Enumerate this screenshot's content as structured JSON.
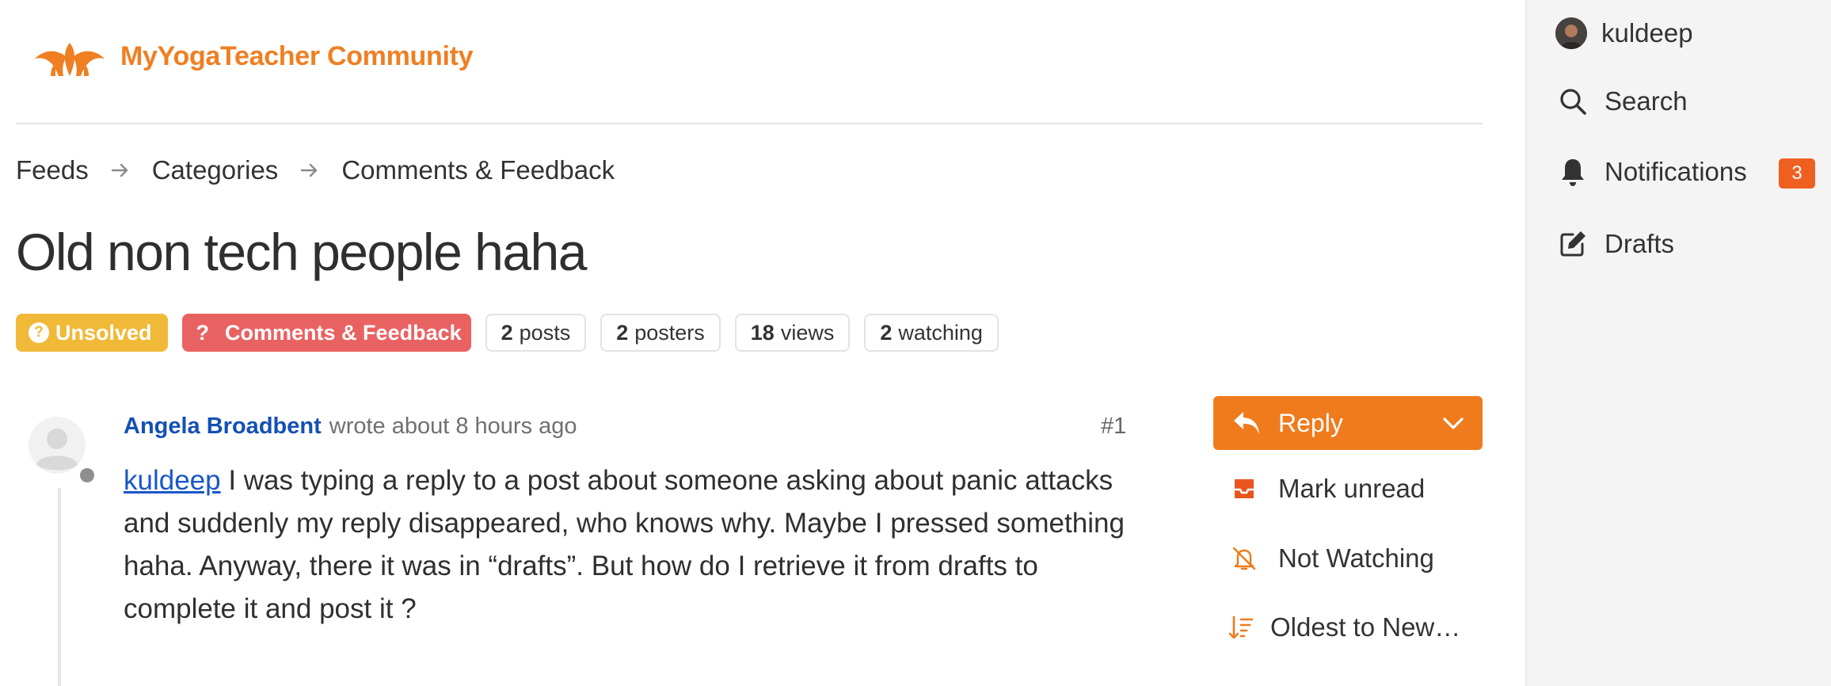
{
  "header": {
    "brand": "MyYogaTeacher Community",
    "logo_icon": "lotus-logo-icon",
    "accent": "#ef7f22"
  },
  "breadcrumb": {
    "items": [
      "Feeds",
      "Categories",
      "Comments & Feedback"
    ]
  },
  "topic": {
    "title": "Old non tech people haha",
    "status": "Unsolved",
    "category": "Comments & Feedback",
    "stats": [
      {
        "count": "2",
        "label": "posts"
      },
      {
        "count": "2",
        "label": "posters"
      },
      {
        "count": "18",
        "label": "views"
      },
      {
        "count": "2",
        "label": "watching"
      }
    ]
  },
  "post": {
    "author": "Angela Broadbent",
    "meta": "wrote about 8 hours ago",
    "number": "#1",
    "mention": "kuldeep",
    "body": " I was typing a reply to a post about someone asking about panic attacks and suddenly my reply disappeared, who knows why. Maybe I pressed something haha. Anyway, there it was in “drafts”. But how do I retrieve it from drafts to complete it and post it ?"
  },
  "actions": {
    "reply": "Reply",
    "mark_unread": "Mark unread",
    "watching": "Not Watching",
    "order": "Oldest to New…"
  },
  "sidebar": {
    "user": "kuldeep",
    "search": "Search",
    "notifications": "Notifications",
    "notification_count": "3",
    "drafts": "Drafts"
  },
  "colors": {
    "status_unsolved": "#f1b938",
    "category": "#e96262",
    "author_link": "#1450b4",
    "reply_button": "#ef7b1d",
    "badge": "#ef6020"
  }
}
